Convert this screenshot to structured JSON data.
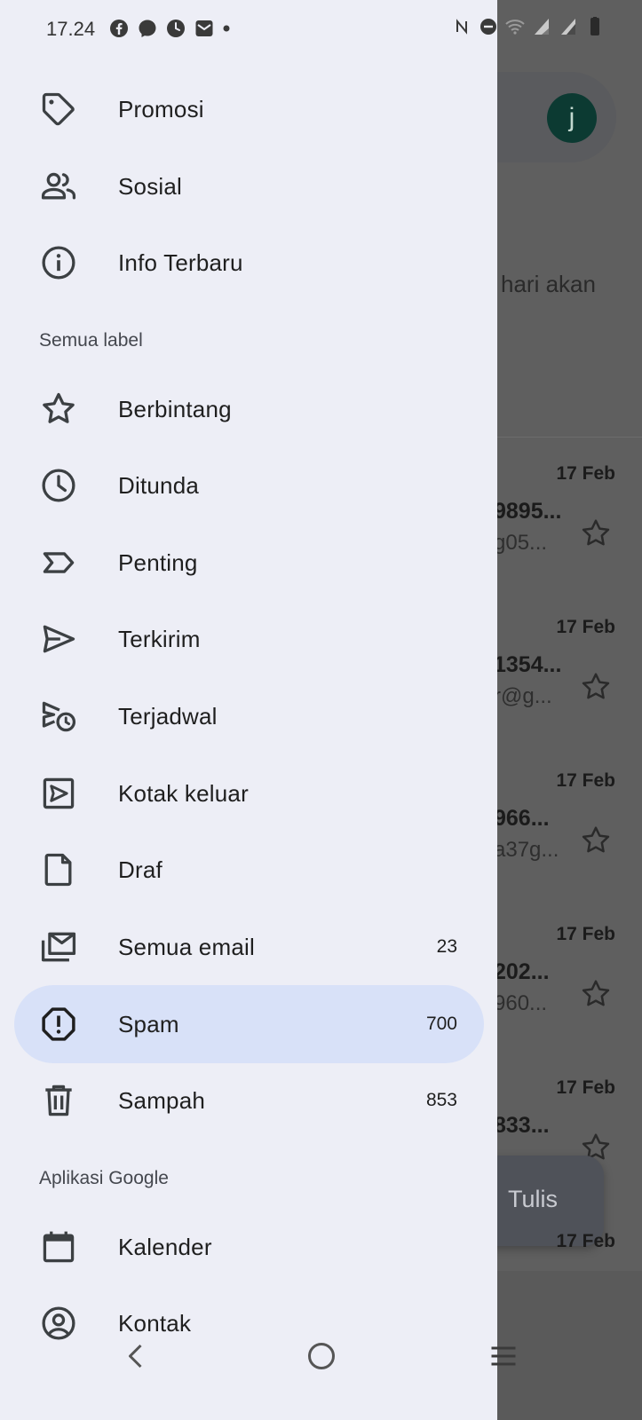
{
  "status_bar": {
    "time": "17.24",
    "left_icons": [
      "facebook-icon",
      "messenger-icon",
      "clock-app-icon",
      "mail-icon",
      "dot-icon"
    ],
    "right_icons": [
      "nfc-icon",
      "dnd-icon",
      "wifi-icon",
      "signal-icon",
      "signal-icon",
      "battery-icon"
    ]
  },
  "drawer": {
    "items_top": [
      {
        "label": "Promosi",
        "icon": "tag-icon"
      },
      {
        "label": "Sosial",
        "icon": "people-icon"
      },
      {
        "label": "Info Terbaru",
        "icon": "info-icon"
      }
    ],
    "section_all_labels": "Semua label",
    "items_labels": [
      {
        "label": "Berbintang",
        "icon": "star-icon",
        "count": ""
      },
      {
        "label": "Ditunda",
        "icon": "clock-icon",
        "count": ""
      },
      {
        "label": "Penting",
        "icon": "important-icon",
        "count": ""
      },
      {
        "label": "Terkirim",
        "icon": "send-icon",
        "count": ""
      },
      {
        "label": "Terjadwal",
        "icon": "scheduled-send-icon",
        "count": ""
      },
      {
        "label": "Kotak keluar",
        "icon": "outbox-icon",
        "count": ""
      },
      {
        "label": "Draf",
        "icon": "draft-icon",
        "count": ""
      },
      {
        "label": "Semua email",
        "icon": "all-mail-icon",
        "count": "23"
      },
      {
        "label": "Spam",
        "icon": "spam-icon",
        "count": "700",
        "selected": true
      },
      {
        "label": "Sampah",
        "icon": "trash-icon",
        "count": "853"
      }
    ],
    "section_google_apps": "Aplikasi Google",
    "items_apps": [
      {
        "label": "Kalender",
        "icon": "calendar-icon"
      },
      {
        "label": "Kontak",
        "icon": "contacts-icon"
      }
    ]
  },
  "background": {
    "avatar_letter": "j",
    "banner_fragment": "hari akan",
    "emails": [
      {
        "date": "17 Feb",
        "sender": "9895...",
        "snippet": "g05..."
      },
      {
        "date": "17 Feb",
        "sender": "1354...",
        "snippet": "r@g..."
      },
      {
        "date": "17 Feb",
        "sender": "966...",
        "snippet": "a37g..."
      },
      {
        "date": "17 Feb",
        "sender": "202...",
        "snippet": "960..."
      },
      {
        "date": "17 Feb",
        "sender": "833...",
        "snippet": ""
      },
      {
        "date": "17 Feb",
        "sender": "",
        "snippet": ""
      }
    ],
    "compose_label": "Tulis"
  },
  "colors": {
    "drawer_bg": "#edeef6",
    "selected_bg": "#d8e1f8",
    "scrim": "#5f5f5f",
    "text": "#1f1f1f"
  }
}
